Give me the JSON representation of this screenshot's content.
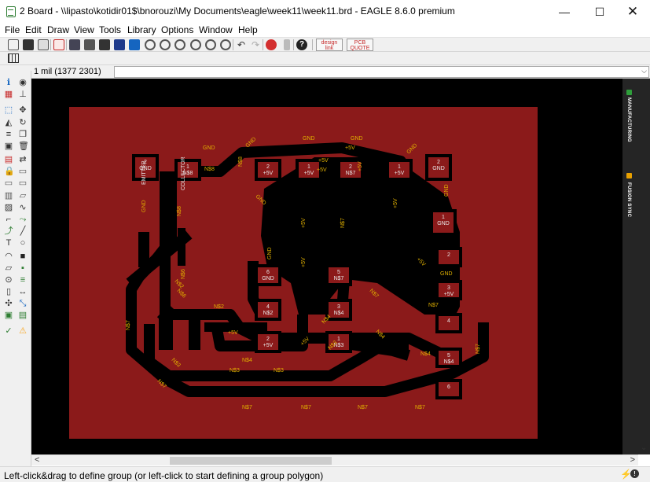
{
  "window": {
    "title": "2 Board - \\\\lipasto\\kotidir01$\\bnorouzi\\My Documents\\eagle\\week11\\week11.brd - EAGLE 8.6.0 premium",
    "minimize_glyph": "—",
    "maximize_glyph": "☐",
    "close_glyph": "✕"
  },
  "menu": [
    "File",
    "Edit",
    "Draw",
    "View",
    "Tools",
    "Library",
    "Options",
    "Window",
    "Help"
  ],
  "toolbar": {
    "icons": [
      "open-icon",
      "save-icon",
      "print-icon",
      "cam-icon",
      "board-icon",
      "library-icon",
      "script-icon",
      "ulp-icon",
      "zoom-fit-icon",
      "zoom-in-icon",
      "zoom-out-icon",
      "zoom-previous-icon",
      "zoom-select-icon",
      "redraw-icon",
      "undo-icon",
      "redo-icon",
      "stop-icon",
      "go-icon",
      "help-icon",
      "design-link-icon",
      "pcb-quote-icon"
    ],
    "design_link_label": "design link",
    "pcb_quote_label": "PCB QUOTE"
  },
  "command_bar": {
    "coordinate": "1 mil (1377 2301)",
    "command_value": "",
    "dropdown_glyph": "⌵"
  },
  "left_toolbar": {
    "tools": [
      "info-icon",
      "show-icon",
      "display-layers-icon",
      "mark-icon",
      "group-icon",
      "move-icon",
      "mirror-icon",
      "rotate-icon",
      "align-icon",
      "copy-icon",
      "paste-icon",
      "delete-icon",
      "add-icon",
      "replace-icon",
      "lock-icon",
      "name-icon",
      "value-icon",
      "smash-icon",
      "change-icon",
      "split-icon",
      "optimize-icon",
      "meander-icon",
      "miter-icon",
      "route-icon",
      "ripup-icon",
      "wire-icon",
      "text-icon",
      "circle-icon",
      "arc-icon",
      "rect-icon",
      "polygon-icon",
      "via-icon",
      "hole-icon",
      "signal-icon",
      "attribute-icon",
      "dimension-icon",
      "ratsnest-icon",
      "autorouter-icon",
      "errors-icon",
      "drc-icon",
      "erc-icon",
      "warning-icon"
    ]
  },
  "board": {
    "colors": {
      "background": "#000000",
      "copper": "#8b1a1a",
      "label": "#e0b000",
      "pad": "#8b1a1a",
      "pad_label": "#e8e8e8"
    },
    "pads": [
      {
        "name": "2",
        "label": "GND"
      },
      {
        "name": "1",
        "label": "N$8"
      },
      {
        "name": "2",
        "label": "+5V"
      },
      {
        "name": "1",
        "label": "+5V"
      },
      {
        "name": "2",
        "label": "N$7"
      },
      {
        "name": "1",
        "label": "+5V"
      },
      {
        "name": "2",
        "label": "GND"
      },
      {
        "name": "1",
        "label": "GND"
      },
      {
        "name": "2",
        "label": ""
      },
      {
        "name": "3",
        "label": "+5V"
      },
      {
        "name": "4",
        "label": ""
      },
      {
        "name": "5",
        "label": "N$4"
      },
      {
        "name": "6",
        "label": ""
      },
      {
        "name": "6",
        "label": "GND"
      },
      {
        "name": "5",
        "label": "N$7"
      },
      {
        "name": "4",
        "label": "N$2"
      },
      {
        "name": "3",
        "label": "N$4"
      },
      {
        "name": "2",
        "label": "+5V"
      },
      {
        "name": "1",
        "label": "N$3"
      }
    ],
    "net_labels": [
      "GND",
      "GND",
      "GND",
      "GND",
      "GND",
      "GND",
      "GND",
      "GND",
      "GND",
      "GND",
      "+5V",
      "+5V",
      "+5V",
      "+5V",
      "+5V",
      "+5V",
      "+5V",
      "+5V",
      "+5V",
      "+5V",
      "N$8",
      "N$8",
      "N$8",
      "N$7",
      "N$7",
      "N$7",
      "N$7",
      "N$7",
      "N$7",
      "N$7",
      "N$7",
      "N$7",
      "N$7",
      "N$2",
      "N$2",
      "N$3",
      "N$3",
      "N$3",
      "N$3",
      "N$4",
      "N$4",
      "N$4",
      "N$4",
      "N$6",
      "N$6"
    ],
    "rotated_labels": [
      "EMITTER",
      "COLLECTOR"
    ]
  },
  "right_panel": {
    "items": [
      {
        "label": "MANUFACTURING",
        "color": "#2e9e3a"
      },
      {
        "label": "FUSION SYNC",
        "color": "#e8a000"
      }
    ]
  },
  "scrollbars": {
    "left_glyph": "<",
    "right_glyph": ">",
    "down_glyph": "⌄"
  },
  "status": {
    "text": "Left-click&drag to define group (or left-click to start defining a group polygon)",
    "lightning_glyph": "⚡",
    "stop_glyph": "!"
  }
}
